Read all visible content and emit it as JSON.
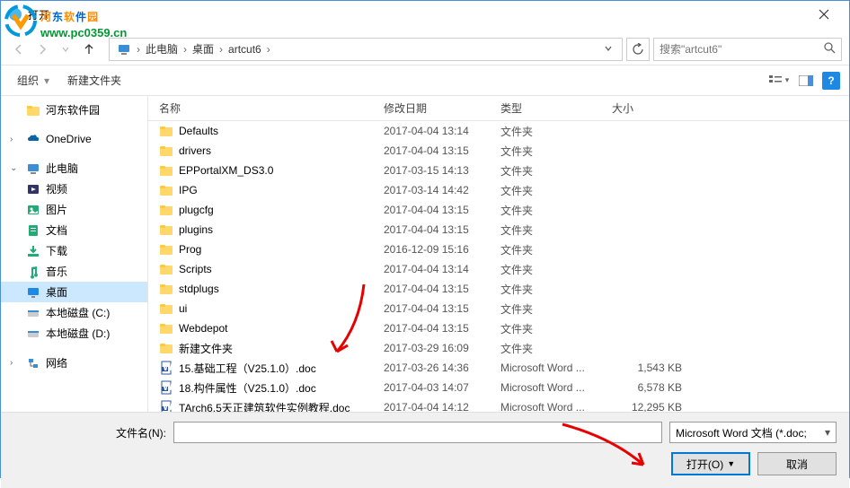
{
  "window": {
    "title": "打开"
  },
  "watermark": {
    "text": "河东软件园",
    "url": "www.pc0359.cn"
  },
  "breadcrumb": {
    "segments": [
      "此电脑",
      "桌面",
      "artcut6"
    ]
  },
  "search": {
    "placeholder": "搜索\"artcut6\""
  },
  "toolbar": {
    "organize": "组织",
    "newfolder": "新建文件夹"
  },
  "sidebar": {
    "items": [
      {
        "label": "河东软件园",
        "icon": "folder",
        "level": 1
      },
      {
        "spacer": true
      },
      {
        "label": "OneDrive",
        "icon": "onedrive",
        "level": 0,
        "exp": ">"
      },
      {
        "spacer": true
      },
      {
        "label": "此电脑",
        "icon": "pc",
        "level": 0,
        "exp": "v"
      },
      {
        "label": "视频",
        "icon": "video",
        "level": 1
      },
      {
        "label": "图片",
        "icon": "pictures",
        "level": 1
      },
      {
        "label": "文档",
        "icon": "docs",
        "level": 1
      },
      {
        "label": "下载",
        "icon": "downloads",
        "level": 1
      },
      {
        "label": "音乐",
        "icon": "music",
        "level": 1
      },
      {
        "label": "桌面",
        "icon": "desktop",
        "level": 1,
        "selected": true
      },
      {
        "label": "本地磁盘 (C:)",
        "icon": "disk",
        "level": 1
      },
      {
        "label": "本地磁盘 (D:)",
        "icon": "disk",
        "level": 1
      },
      {
        "spacer": true
      },
      {
        "label": "网络",
        "icon": "network",
        "level": 0,
        "exp": ">"
      }
    ]
  },
  "columns": {
    "name": "名称",
    "date": "修改日期",
    "type": "类型",
    "size": "大小"
  },
  "files": [
    {
      "name": "Defaults",
      "date": "2017-04-04 13:14",
      "type": "文件夹",
      "size": "",
      "icon": "folder"
    },
    {
      "name": "drivers",
      "date": "2017-04-04 13:15",
      "type": "文件夹",
      "size": "",
      "icon": "folder"
    },
    {
      "name": "EPPortalXM_DS3.0",
      "date": "2017-03-15 14:13",
      "type": "文件夹",
      "size": "",
      "icon": "folder"
    },
    {
      "name": "IPG",
      "date": "2017-03-14 14:42",
      "type": "文件夹",
      "size": "",
      "icon": "folder"
    },
    {
      "name": "plugcfg",
      "date": "2017-04-04 13:15",
      "type": "文件夹",
      "size": "",
      "icon": "folder"
    },
    {
      "name": "plugins",
      "date": "2017-04-04 13:15",
      "type": "文件夹",
      "size": "",
      "icon": "folder"
    },
    {
      "name": "Prog",
      "date": "2016-12-09 15:16",
      "type": "文件夹",
      "size": "",
      "icon": "folder"
    },
    {
      "name": "Scripts",
      "date": "2017-04-04 13:14",
      "type": "文件夹",
      "size": "",
      "icon": "folder"
    },
    {
      "name": "stdplugs",
      "date": "2017-04-04 13:15",
      "type": "文件夹",
      "size": "",
      "icon": "folder"
    },
    {
      "name": "ui",
      "date": "2017-04-04 13:15",
      "type": "文件夹",
      "size": "",
      "icon": "folder"
    },
    {
      "name": "Webdepot",
      "date": "2017-04-04 13:15",
      "type": "文件夹",
      "size": "",
      "icon": "folder"
    },
    {
      "name": "新建文件夹",
      "date": "2017-03-29 16:09",
      "type": "文件夹",
      "size": "",
      "icon": "folder"
    },
    {
      "name": "15.基础工程（V25.1.0）.doc",
      "date": "2017-03-26 14:36",
      "type": "Microsoft Word ...",
      "size": "1,543 KB",
      "icon": "doc"
    },
    {
      "name": "18.构件属性（V25.1.0）.doc",
      "date": "2017-04-03 14:07",
      "type": "Microsoft Word ...",
      "size": "6,578 KB",
      "icon": "doc"
    },
    {
      "name": "TArch6.5天正建筑软件实例教程.doc",
      "date": "2017-04-04 14:12",
      "type": "Microsoft Word ...",
      "size": "12,295 KB",
      "icon": "doc"
    }
  ],
  "bottom": {
    "filename_label": "文件名(N):",
    "filter": "Microsoft Word 文档 (*.doc;",
    "open": "打开(O)",
    "cancel": "取消"
  }
}
